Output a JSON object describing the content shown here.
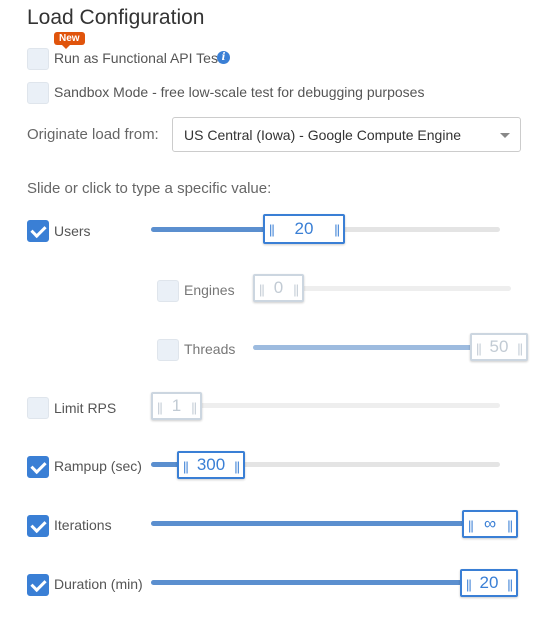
{
  "title": "Load Configuration",
  "functional": {
    "badge": "New",
    "label": "Run as Functional API Test",
    "checked": false,
    "icon": "info-icon"
  },
  "sandbox": {
    "label": "Sandbox Mode - free low-scale test for debugging purposes",
    "checked": false
  },
  "origin": {
    "label": "Originate load from:",
    "value": "US Central (Iowa) - Google Compute Engine"
  },
  "slide_hint": "Slide or click to type a specific value:",
  "grip": "||",
  "sliders": {
    "users": {
      "label": "Users",
      "checked": true,
      "value": "20"
    },
    "engines": {
      "label": "Engines",
      "checked": false,
      "value": "0"
    },
    "threads": {
      "label": "Threads",
      "checked": false,
      "value": "50"
    },
    "rps": {
      "label": "Limit RPS",
      "checked": false,
      "value": "1"
    },
    "rampup": {
      "label": "Rampup (sec)",
      "checked": true,
      "value": "300"
    },
    "iterations": {
      "label": "Iterations",
      "checked": true,
      "value": "∞"
    },
    "duration": {
      "label": "Duration (min)",
      "checked": true,
      "value": "20"
    }
  },
  "colors": {
    "accent": "#3a7fd5",
    "badge": "#e0540c"
  }
}
